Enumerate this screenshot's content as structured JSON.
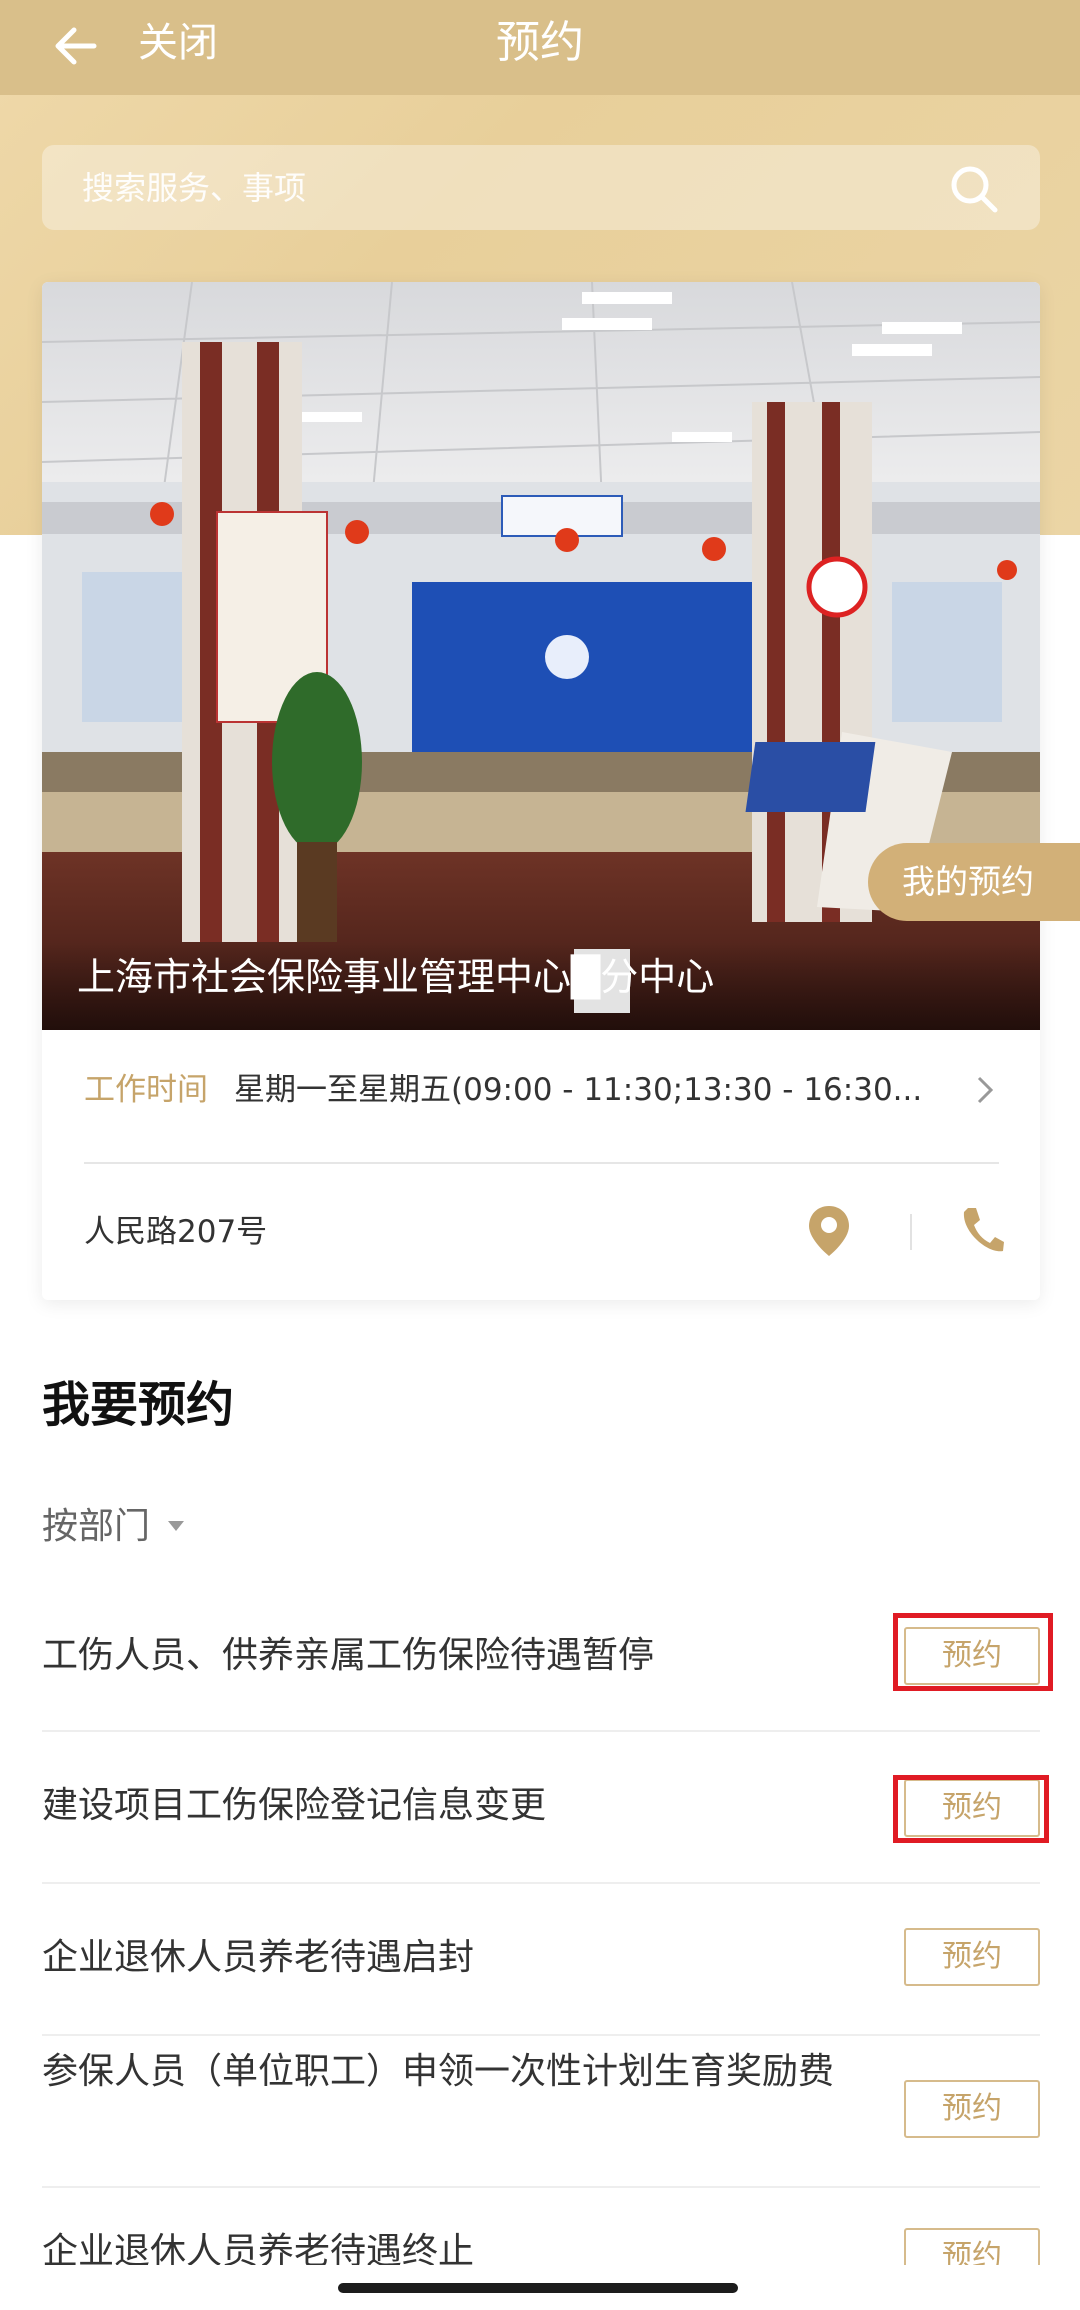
{
  "nav": {
    "close_label": "关闭",
    "title": "预约"
  },
  "search": {
    "placeholder": "搜索服务、事项"
  },
  "center": {
    "photo_caption": "上海市社会保险事业管理中心█分中心",
    "hours_label": "工作时间",
    "hours_value": "星期一至星期五(09:00 - 11:30;13:30 - 16:30...",
    "address": "人民路207号"
  },
  "my_booking_label": "我的预约",
  "section": {
    "title": "我要预约",
    "filter_label": "按部门"
  },
  "items": [
    {
      "text": "工伤人员、供养亲属工伤保险待遇暂停",
      "button": "预约"
    },
    {
      "text": "建设项目工伤保险登记信息变更",
      "button": "预约"
    },
    {
      "text": "企业退休人员养老待遇启封",
      "button": "预约"
    },
    {
      "text": "参保人员（单位职工）申领一次性计划生育奖励费",
      "button": "预约"
    },
    {
      "text": "企业退休人员养老待遇终止",
      "button": "预约"
    }
  ],
  "colors": {
    "accent": "#c6a46a",
    "header": "#d9bf8a",
    "highlight": "#e01b24"
  }
}
